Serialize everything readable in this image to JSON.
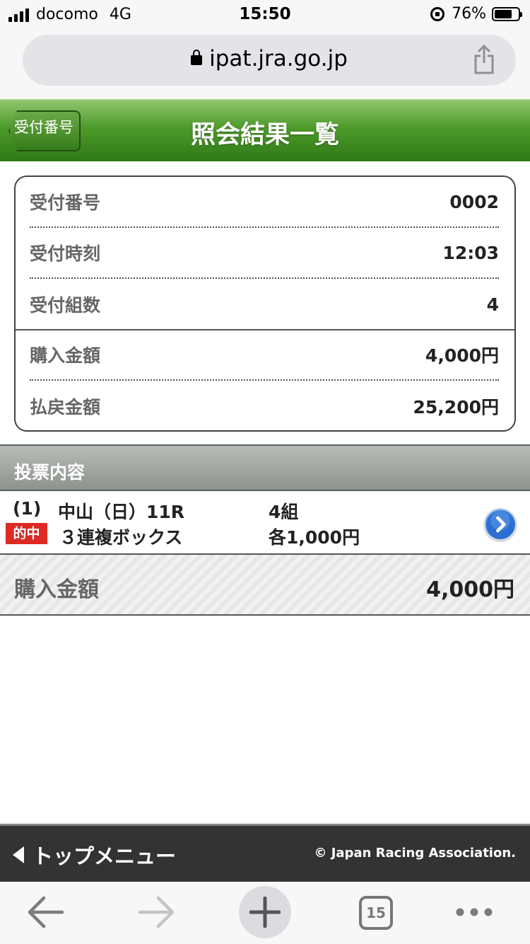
{
  "status_bar": {
    "carrier": "docomo",
    "network": "4G",
    "time": "15:50",
    "battery_percent": "76%",
    "battery_level": 0.76
  },
  "browser": {
    "url": "ipat.jra.go.jp"
  },
  "header": {
    "back_label": "受付番号",
    "title": "照会結果一覧"
  },
  "summary": {
    "rows": [
      {
        "label": "受付番号",
        "value": "0002"
      },
      {
        "label": "受付時刻",
        "value": "12:03"
      },
      {
        "label": "受付組数",
        "value": "4"
      },
      {
        "label": "購入金額",
        "value": "4,000円"
      },
      {
        "label": "払戻金額",
        "value": "25,200円"
      }
    ]
  },
  "section": {
    "title": "投票内容"
  },
  "bet": {
    "number": "(1)",
    "race": "中山（日）11R",
    "combos": "4組",
    "result_badge": "的中",
    "bet_type": "３連複ボックス",
    "amount_each": "各1,000円"
  },
  "total": {
    "label": "購入金額",
    "value": "4,000円"
  },
  "footer": {
    "top_menu_label": "トップメニュー",
    "copyright": "© Japan Racing Association."
  },
  "toolbar": {
    "tab_count": "15"
  },
  "colors": {
    "header_green": "#4d9a2a",
    "hit_badge_red": "#dd2a25",
    "footer_dark": "#333333",
    "arrow_blue": "#2a6fd1"
  },
  "icons": [
    "signal-icon",
    "orientation-lock-icon",
    "battery-icon",
    "lock-icon",
    "share-icon",
    "chevron-right-icon",
    "back-arrow-icon",
    "forward-arrow-icon",
    "plus-icon",
    "tabs-icon",
    "more-icon"
  ]
}
